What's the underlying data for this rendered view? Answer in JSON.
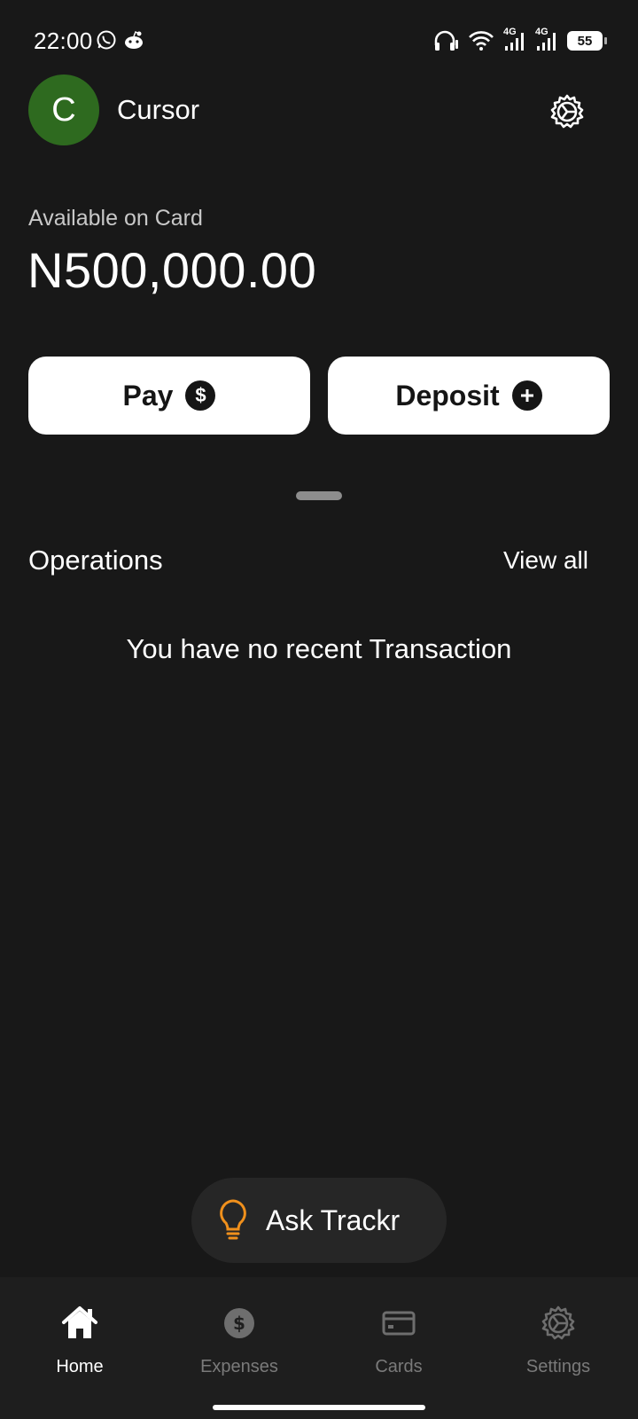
{
  "status_bar": {
    "time": "22:00",
    "battery": "55",
    "network_1": "4G",
    "network_2": "4G"
  },
  "header": {
    "avatar_initial": "C",
    "user_name": "Cursor",
    "avatar_color": "#2e6a1f"
  },
  "balance": {
    "label": "Available on Card",
    "amount": "N500,000.00"
  },
  "actions": {
    "pay_label": "Pay",
    "deposit_label": "Deposit"
  },
  "operations": {
    "title": "Operations",
    "view_all_label": "View all",
    "empty_message": "You have no recent Transaction"
  },
  "assistant": {
    "label": "Ask Trackr",
    "icon": "lightbulb-icon",
    "icon_color": "#f0901c"
  },
  "nav": {
    "items": [
      {
        "label": "Home",
        "icon": "home-icon",
        "active": true
      },
      {
        "label": "Expenses",
        "icon": "dollar-circle-icon",
        "active": false
      },
      {
        "label": "Cards",
        "icon": "card-icon",
        "active": false
      },
      {
        "label": "Settings",
        "icon": "gear-icon",
        "active": false
      }
    ]
  }
}
